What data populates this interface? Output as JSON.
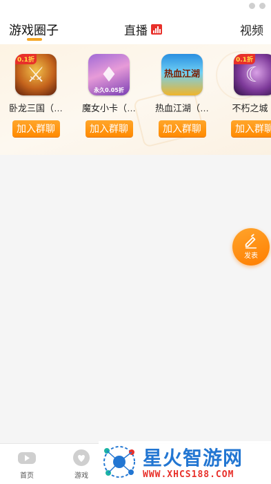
{
  "header": {
    "tabs": [
      {
        "label": "游戏圈子",
        "active": true
      },
      {
        "label": "直播",
        "icon": "live-chart-icon"
      },
      {
        "label": "视频"
      }
    ],
    "accent_color": "#f5a623"
  },
  "games": [
    {
      "name": "卧龙三国（…",
      "badge": "0.1折",
      "icon": "game-icon-wolong",
      "action": "加入群聊"
    },
    {
      "name": "魔女小卡（…",
      "badge": "",
      "icon_text": "永久0.05折",
      "icon": "game-icon-monv",
      "action": "加入群聊"
    },
    {
      "name": "热血江湖（…",
      "badge": "",
      "icon_text": "热血江湖",
      "icon": "game-icon-rexue",
      "action": "加入群聊"
    },
    {
      "name": "不朽之城（",
      "badge": "0.1折",
      "icon": "game-icon-buxiu",
      "action": "加入群聊"
    }
  ],
  "fab": {
    "label": "发表",
    "icon": "pencil-icon",
    "color": "#ff8a00"
  },
  "bottom_nav": [
    {
      "label": "首页",
      "icon": "gamepad-icon"
    },
    {
      "label": "游戏",
      "icon": "heart-bubble-icon"
    }
  ],
  "watermark": {
    "title": "星火智游网",
    "url": "WWW.XHCS188.COM",
    "title_color": "#2276d2",
    "url_color": "#e8302a"
  }
}
